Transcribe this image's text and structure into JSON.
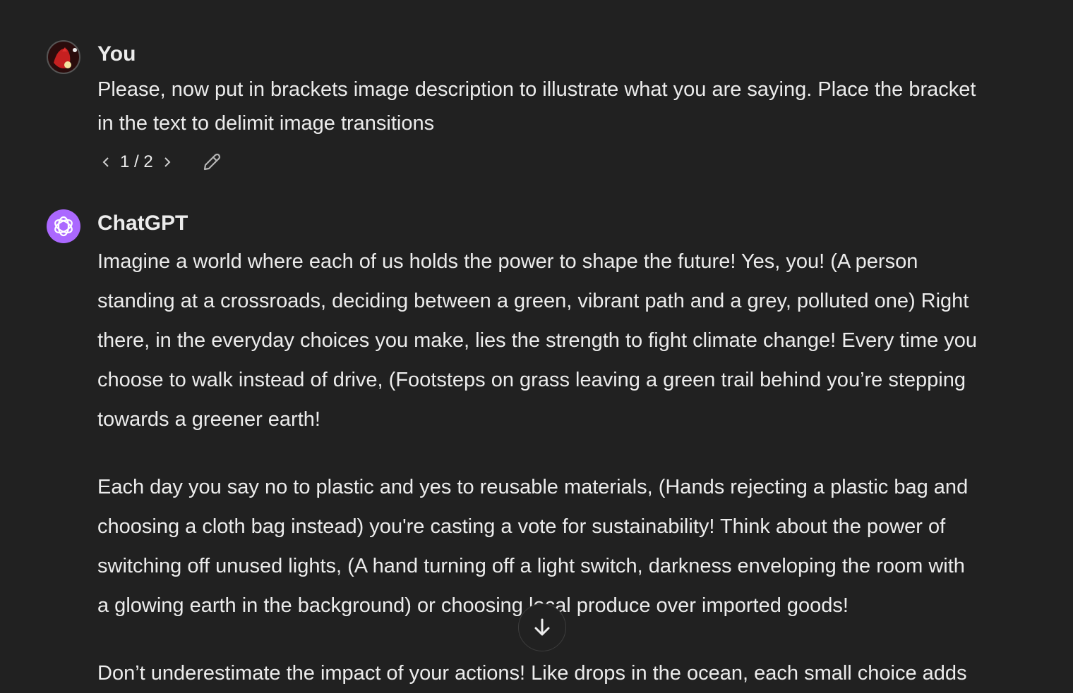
{
  "user_message": {
    "author": "You",
    "lines": [
      "Please, now put in brackets image description to illustrate what you are saying. Place the bracket",
      "in the text to delimit image transitions"
    ],
    "pager": "1 / 2"
  },
  "assistant_message": {
    "author": "ChatGPT",
    "paragraphs": [
      [
        "Imagine a world where each of us holds the power to shape the future! Yes, you! (A person",
        "standing at a crossroads, deciding between a green, vibrant path and a grey, polluted one) Right",
        "there, in the everyday choices you make, lies the strength to fight climate change! Every time you",
        "choose to walk instead of drive, (Footsteps on grass leaving a green trail behind you’re stepping",
        "towards a greener earth!"
      ],
      [
        "Each day you say no to plastic and yes to reusable materials, (Hands rejecting a plastic bag and",
        "choosing a cloth bag instead) you're casting a vote for sustainability! Think about the power of",
        "switching off unused lights, (A hand turning off a light switch, darkness enveloping the room with",
        "a glowing earth in the background) or choosing local produce over imported goods!"
      ],
      [
        "Don’t underestimate the impact of your actions! Like drops in the ocean, each small choice adds"
      ]
    ]
  },
  "colors": {
    "background": "#212121",
    "text": "#ececec",
    "chatgpt_avatar": "#ab68ff"
  }
}
